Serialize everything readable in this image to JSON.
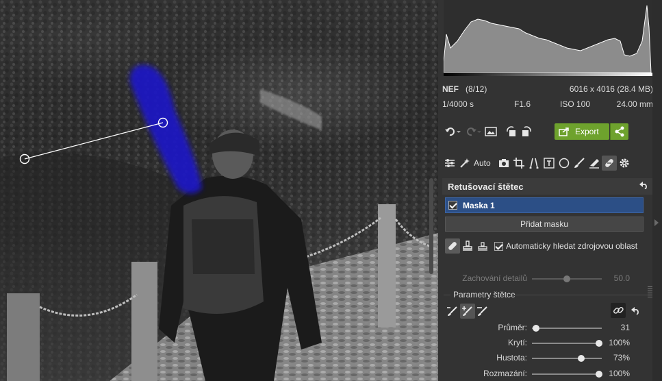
{
  "file": {
    "format": "NEF",
    "index": "(8/12)",
    "dimensions": "6016 x 4016 (28.4 MB)",
    "shutter": "1/4000 s",
    "aperture": "F1.6",
    "iso": "ISO 100",
    "focal_length": "24.00 mm"
  },
  "toolbar": {
    "export_label": "Export",
    "auto_label": "Auto"
  },
  "tool_icons": [
    "sliders-icon",
    "magic-wand-icon",
    "camera-icon",
    "crop-icon",
    "perspective-icon",
    "text-icon",
    "circle-icon",
    "brush-icon",
    "eraser-icon",
    "retouch-icon",
    "gear-icon"
  ],
  "retouch": {
    "title": "Retušovací štětec",
    "mask_name": "Maska 1",
    "mask_checked": true,
    "add_mask_label": "Přidat masku",
    "auto_source_label": "Automaticky hledat zdrojovou oblast",
    "auto_source_checked": true,
    "detail": {
      "label": "Zachování detailů",
      "value": "50.0",
      "level": 0.5
    },
    "params_title": "Parametry štětce",
    "sliders": [
      {
        "label": "Průměr:",
        "value": "31",
        "level": 0.06
      },
      {
        "label": "Krytí:",
        "value": "100%",
        "level": 0.96
      },
      {
        "label": "Hustota:",
        "value": "73%",
        "level": 0.71
      },
      {
        "label": "Rozmazání:",
        "value": "100%",
        "level": 0.96
      }
    ]
  },
  "colors": {
    "accent_green": "#6ea22d",
    "mask_blue": "#2c4f86",
    "retouch_stroke": "#1a12c8"
  }
}
